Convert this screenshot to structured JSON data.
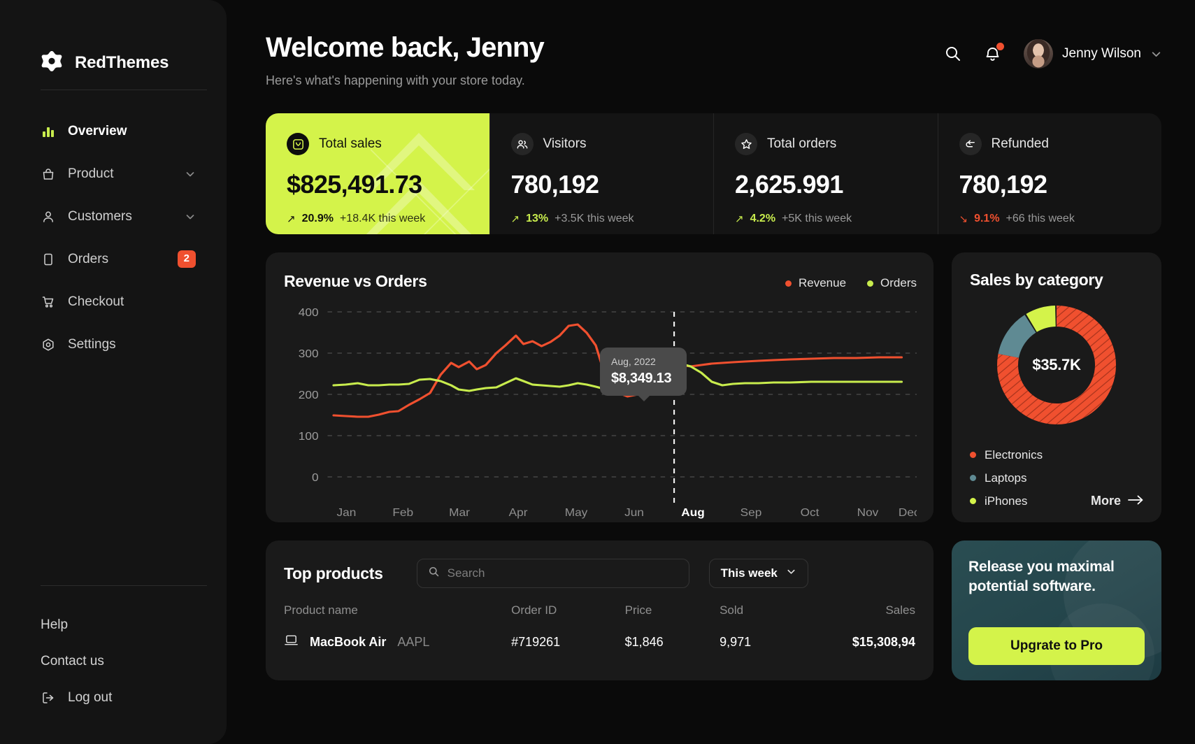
{
  "brand": {
    "name": "RedThemes",
    "logo_icon": "redthemes-logo-icon"
  },
  "sidebar": {
    "items": [
      {
        "label": "Overview",
        "icon": "bar-chart-icon",
        "active": true
      },
      {
        "label": "Product",
        "icon": "bag-icon",
        "chevron": true
      },
      {
        "label": "Customers",
        "icon": "user-icon",
        "chevron": true
      },
      {
        "label": "Orders",
        "icon": "tablet-icon",
        "badge": "2"
      },
      {
        "label": "Checkout",
        "icon": "cart-icon"
      },
      {
        "label": "Settings",
        "icon": "gear-target-icon"
      }
    ],
    "footer": [
      {
        "label": "Help"
      },
      {
        "label": "Contact us"
      },
      {
        "label": "Log out",
        "icon": "logout-icon"
      }
    ]
  },
  "header": {
    "title": "Welcome back, Jenny",
    "subtitle": "Here's what's happening with your store today.",
    "search_icon": "search-icon",
    "notification_icon": "bell-icon",
    "user_name": "Jenny Wilson",
    "user_chevron": "chevron-down-icon"
  },
  "stats": [
    {
      "label": "Total sales",
      "value": "$825,491.73",
      "pct": "20.9%",
      "note": "+18.4K this week",
      "dir": "up",
      "icon": "sales-box-icon",
      "highlight": true
    },
    {
      "label": "Visitors",
      "value": "780,192",
      "pct": "13%",
      "note": "+3.5K this week",
      "dir": "up",
      "icon": "visitors-icon",
      "highlight": false
    },
    {
      "label": "Total orders",
      "value": "2,625.991",
      "pct": "4.2%",
      "note": "+5K this week",
      "dir": "up",
      "icon": "star-icon",
      "highlight": false
    },
    {
      "label": "Refunded",
      "value": "780,192",
      "pct": "9.1%",
      "note": "+66 this week",
      "dir": "down",
      "icon": "return-icon",
      "highlight": false
    }
  ],
  "revenue_card": {
    "title": "Revenue vs Orders",
    "legend": [
      {
        "label": "Revenue",
        "color": "#f0502f"
      },
      {
        "label": "Orders",
        "color": "#c8ec4d"
      }
    ],
    "tooltip": {
      "date": "Aug, 2022",
      "value": "$8,349.13"
    }
  },
  "category_card": {
    "title": "Sales by category",
    "center_value": "$35.7K",
    "legend": [
      {
        "label": "Electronics",
        "color": "#f0502f"
      },
      {
        "label": "Laptops",
        "color": "#5f8a93"
      },
      {
        "label": "iPhones",
        "color": "#d4f34a"
      }
    ],
    "more_label": "More",
    "more_icon": "arrow-right-icon"
  },
  "products_card": {
    "title": "Top products",
    "search_placeholder": "Search",
    "search_value": "",
    "search_icon": "search-icon",
    "range_label": "This week",
    "range_chevron": "chevron-down-icon",
    "columns": [
      "Product name",
      "Order ID",
      "Price",
      "Sold",
      "Sales"
    ],
    "rows": [
      {
        "icon": "laptop-icon",
        "name": "MacBook Air",
        "ticker": "AAPL",
        "order_id": "#719261",
        "price": "$1,846",
        "sold": "9,971",
        "sales": "$15,308,94"
      }
    ]
  },
  "promo": {
    "text": "Release you maximal potential software.",
    "button_label": "Upgrate to Pro"
  },
  "chart_data": {
    "type": "line",
    "title": "Revenue vs Orders",
    "xlabel": "",
    "ylabel": "",
    "ylim": [
      0,
      450
    ],
    "yticks": [
      0,
      100,
      200,
      300,
      400
    ],
    "grid": true,
    "legend_position": "top-right",
    "categories": [
      "Jan",
      "Feb",
      "Mar",
      "Apr",
      "May",
      "Jun",
      "Aug",
      "Sep",
      "Oct",
      "Nov",
      "Dec"
    ],
    "highlighted_category": "Aug",
    "annotation": {
      "x": "Aug",
      "label": "Aug, 2022",
      "value": "$8,349.13"
    },
    "series": [
      {
        "name": "Revenue",
        "color": "#f0502f",
        "values": [
          150,
          148,
          147,
          146,
          152,
          158,
          160,
          175,
          190,
          205,
          250,
          278,
          268,
          282,
          262,
          272,
          300,
          318,
          345,
          325,
          332,
          318,
          330,
          345,
          368,
          372,
          352,
          318,
          235,
          205,
          195,
          200,
          210,
          232,
          262,
          272,
          268,
          272,
          275,
          278,
          280
        ]
      },
      {
        "name": "Orders",
        "color": "#c8ec4d",
        "values": [
          222,
          225,
          228,
          222,
          222,
          224,
          224,
          226,
          236,
          238,
          232,
          222,
          212,
          208,
          212,
          215,
          218,
          228,
          240,
          232,
          224,
          222,
          220,
          218,
          222,
          228,
          224,
          218,
          212,
          208,
          214,
          218,
          232,
          255,
          272,
          276,
          268,
          252,
          230,
          222,
          226
        ]
      }
    ]
  },
  "donut_data": {
    "type": "pie",
    "title": "Sales by category",
    "center": "$35.7K",
    "labels": [
      "Electronics",
      "Laptops",
      "iPhones"
    ],
    "values": [
      78,
      13,
      9
    ],
    "colors": [
      "#f0502f",
      "#5f8a93",
      "#d4f34a"
    ]
  }
}
